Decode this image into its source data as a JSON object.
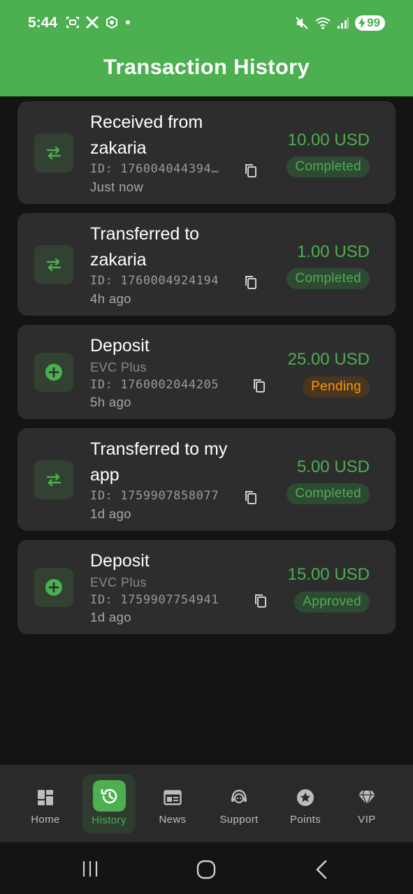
{
  "status_bar": {
    "time": "5:44",
    "battery": "99"
  },
  "header": {
    "title": "Transaction History"
  },
  "transactions": [
    {
      "title": "Received from zakaria",
      "subtitle": "",
      "id": "ID: 176004044394…",
      "time": "Just now",
      "amount": "10.00 USD",
      "status": "Completed",
      "icon": "swap-arrows-icon"
    },
    {
      "title": "Transferred to zakaria",
      "subtitle": "",
      "id": "ID: 1760004924194",
      "time": "4h ago",
      "amount": "1.00 USD",
      "status": "Completed",
      "icon": "swap-arrows-icon"
    },
    {
      "title": "Deposit",
      "subtitle": "EVC Plus",
      "id": "ID: 1760002044205",
      "time": "5h ago",
      "amount": "25.00 USD",
      "status": "Pending",
      "icon": "plus-circle-icon"
    },
    {
      "title": "Transferred to my app",
      "subtitle": "",
      "id": "ID: 1759907858077",
      "time": "1d ago",
      "amount": "5.00 USD",
      "status": "Completed",
      "icon": "swap-arrows-icon"
    },
    {
      "title": "Deposit",
      "subtitle": "EVC Plus",
      "id": "ID: 1759907754941",
      "time": "1d ago",
      "amount": "15.00 USD",
      "status": "Approved",
      "icon": "plus-circle-icon"
    }
  ],
  "nav": {
    "items": [
      {
        "label": "Home",
        "icon": "dashboard-icon"
      },
      {
        "label": "History",
        "icon": "history-icon",
        "active": true
      },
      {
        "label": "News",
        "icon": "news-icon"
      },
      {
        "label": "Support",
        "icon": "support-agent-icon"
      },
      {
        "label": "Points",
        "icon": "star-circle-icon"
      },
      {
        "label": "VIP",
        "icon": "diamond-icon"
      }
    ]
  },
  "colors": {
    "accent": "#4CAF50",
    "pending": "#FF9800",
    "card": "#2d2d2d",
    "background": "#141414"
  }
}
